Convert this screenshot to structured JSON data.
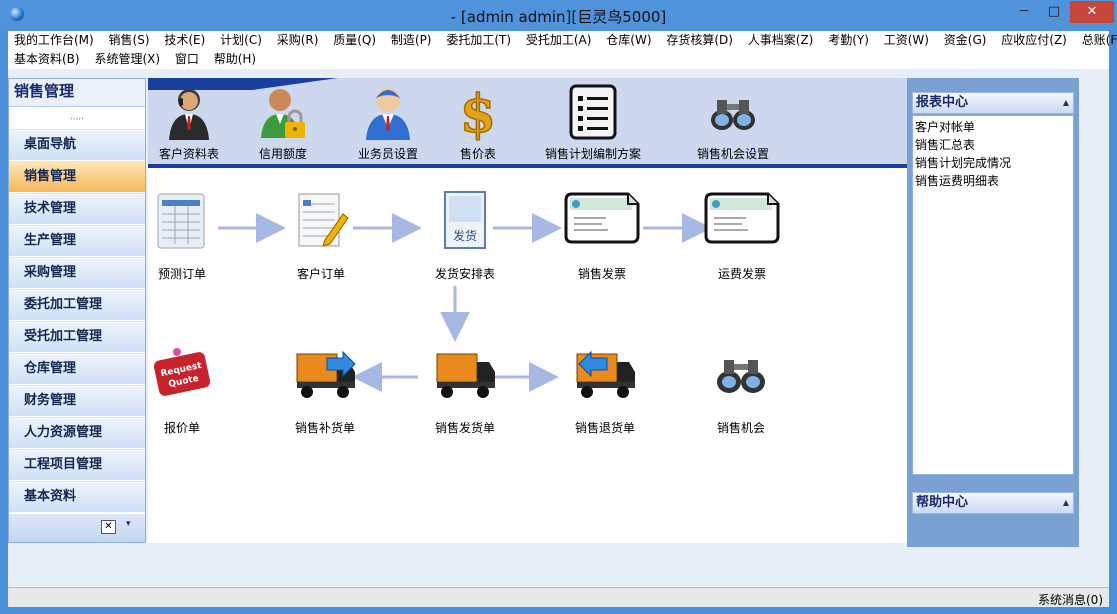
{
  "window": {
    "title": " -  [admin admin][巨灵鸟5000]",
    "minimize": "─",
    "maximize": "□",
    "close": "✕"
  },
  "menu": {
    "row1": [
      "我的工作台(M)",
      "销售(S)",
      "技术(E)",
      "计划(C)",
      "采购(R)",
      "质量(Q)",
      "制造(P)",
      "委托加工(T)",
      "受托加工(A)",
      "仓库(W)",
      "存货核算(D)",
      "人事档案(Z)",
      "考勤(Y)",
      "工资(W)",
      "资金(G)",
      "应收应付(Z)",
      "总账(F)"
    ],
    "row2": [
      "基本资料(B)",
      "系统管理(X)",
      "窗口",
      "帮助(H)"
    ]
  },
  "sidebar": {
    "title": "销售管理",
    "grip": "ʻʻʻʻʻ",
    "items": [
      "桌面导航",
      "销售管理",
      "技术管理",
      "生产管理",
      "采购管理",
      "委托加工管理",
      "受托加工管理",
      "仓库管理",
      "财务管理",
      "人力资源管理",
      "工程项目管理",
      "基本资料"
    ],
    "active_index": 1,
    "config_icon": "configure-icon",
    "arrow_glyph": "▾"
  },
  "toolbar": {
    "items": [
      {
        "label": "客户资料表",
        "icon": "customer-profile-icon"
      },
      {
        "label": "信用额度",
        "icon": "credit-lock-icon"
      },
      {
        "label": "业务员设置",
        "icon": "salesperson-icon"
      },
      {
        "label": "售价表",
        "icon": "dollar-icon"
      },
      {
        "label": "销售计划编制方案",
        "icon": "checklist-icon"
      },
      {
        "label": "销售机会设置",
        "icon": "binoculars-icon"
      }
    ]
  },
  "flow": {
    "row1": [
      {
        "label": "预测订单",
        "icon": "forecast-table-icon"
      },
      {
        "label": "客户订单",
        "icon": "order-form-icon"
      },
      {
        "label": "发货安排表",
        "icon": "shipping-book-icon",
        "icon_text": "发货"
      },
      {
        "label": "销售发票",
        "icon": "invoice-icon"
      },
      {
        "label": "运费发票",
        "icon": "freight-invoice-icon"
      }
    ],
    "row2": [
      {
        "label": "报价单",
        "icon": "request-quote-icon",
        "icon_text": "Request Quote"
      },
      {
        "label": "销售补货单",
        "icon": "replenish-truck-icon"
      },
      {
        "label": "销售发货单",
        "icon": "delivery-truck-icon"
      },
      {
        "label": "销售退货单",
        "icon": "return-truck-icon"
      },
      {
        "label": "销售机会",
        "icon": "binoculars-icon"
      }
    ]
  },
  "report_center": {
    "title": "报表中心",
    "items": [
      "客户对帐单",
      "销售汇总表",
      "销售计划完成情况",
      "销售运费明细表"
    ]
  },
  "help_center": {
    "title": "帮助中心"
  },
  "status": {
    "message": "系统消息(0)"
  },
  "colors": {
    "title_bar": "#4f93dd",
    "banner": "#cdd8ee",
    "accent": "#1a3fa0",
    "active_item": "#f7b858",
    "arrow": "#a8b8e4"
  }
}
